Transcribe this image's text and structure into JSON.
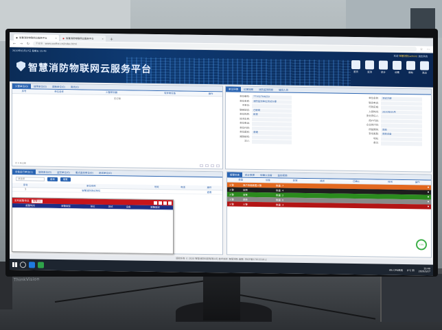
{
  "browser": {
    "tabs": [
      {
        "label": "智慧消防物联网云服务平台",
        "active": true
      },
      {
        "label": "智慧消防物联网云服务平台",
        "active": false
      }
    ],
    "new_tab": "+",
    "url_prefix": "不安全",
    "url": "www.xxxfire.cn/index.html"
  },
  "header": {
    "topline": "2020年03月27日 星期五 15:49",
    "welcome": "欢迎",
    "user": "智慧消防(admin)",
    "logout": "退出系统",
    "title": "智慧消防物联网云服务平台",
    "nav": [
      {
        "label": "首页",
        "icon": "home-icon"
      },
      {
        "label": "监测",
        "icon": "monitor-icon"
      },
      {
        "label": "统计",
        "icon": "chart-icon"
      },
      {
        "label": "设置",
        "icon": "settings-icon"
      },
      {
        "label": "帮助",
        "icon": "help-icon"
      },
      {
        "label": "退出",
        "icon": "logout-icon"
      }
    ]
  },
  "list_panel": {
    "tabs": [
      "火警单位(0)",
      "故障单位(0)",
      "屏蔽单位(0)",
      "离线(0)"
    ],
    "columns": [
      "序号",
      "单位名称",
      "火警探测器",
      "有异常设备",
      "操作"
    ],
    "empty": "无记录",
    "pager": "共 0 条记录"
  },
  "detail_panel": {
    "tabs": [
      "单位详情",
      "位置地图",
      "消防监测视频",
      "值班人员"
    ],
    "left_fields": [
      {
        "k": "单位编号:",
        "v": "77102704650"
      },
      {
        "k": "单位名称:",
        "v": "消防监测单位测试大楼"
      },
      {
        "k": "子单位:",
        "v": ""
      },
      {
        "k": "联网状态:",
        "v": "已联网"
      },
      {
        "k": "单位性质:",
        "v": "民营"
      },
      {
        "k": "技术负责:",
        "v": ""
      },
      {
        "k": "单位电话:",
        "v": ""
      },
      {
        "k": "单位代码:",
        "v": ""
      },
      {
        "k": "单位类别:",
        "v": "普通"
      },
      {
        "k": "建筑结构:",
        "v": ""
      },
      {
        "k": "法人:",
        "v": ""
      }
    ],
    "right_fields": [
      {
        "k": "单位名称:",
        "v": "测试大楼"
      },
      {
        "k": "联系电话:",
        "v": ""
      },
      {
        "k": "行政区域:",
        "v": ""
      },
      {
        "k": "入网时间:",
        "v": "2020年03月"
      },
      {
        "k": "安全责任人:",
        "v": ""
      },
      {
        "k": "用户代码:",
        "v": ""
      },
      {
        "k": "企业统计码:",
        "v": ""
      },
      {
        "k": "所属建筑:",
        "v": "其他"
      },
      {
        "k": "安全类型:",
        "v": "其他设备"
      },
      {
        "k": "地址:",
        "v": ""
      },
      {
        "k": "备注:",
        "v": ""
      }
    ]
  },
  "units_panel": {
    "tabs": [
      "设备运行单位(1)",
      "联网单位(0)",
      "监控单位(0)",
      "重点监控单位(0)",
      "测试单位(0)"
    ],
    "select_placeholder": "请选择",
    "search_label": "查询",
    "reset_label": "重置",
    "columns": [
      "序号",
      "单位名称",
      "地址",
      "电话",
      "操作"
    ],
    "rows": [
      {
        "no": "1",
        "name": "智慧消防测试单位",
        "addr": "",
        "tel": "",
        "op": "查看"
      }
    ]
  },
  "alarm_popup": {
    "title": "实时报警信息",
    "badge": "报警(1)",
    "columns": [
      "报警时间",
      "报警类型",
      "单位",
      "测试",
      "设备",
      "报警描述"
    ]
  },
  "alarm_panel": {
    "tabs": [
      "报警信息",
      "统计数据",
      "待确认设备",
      "监控视频"
    ],
    "columns": [
      "类型",
      "设备",
      "区域",
      "描述",
      "已确认",
      "时间",
      "操作"
    ],
    "rows": [
      {
        "tag": "火警",
        "type": "用户传输装置火警",
        "count": "数量: 7",
        "color": "#e2681f"
      },
      {
        "tag": "火警",
        "type": "故障",
        "count": "数量: 4",
        "color": "#1e1e1e"
      },
      {
        "tag": "火警",
        "type": "监管",
        "count": "数量: 2",
        "color": "#2b8a1e"
      },
      {
        "tag": "火警",
        "type": "屏蔽",
        "count": "数量: 0",
        "color": "#8a8a8a"
      },
      {
        "tag": "火警",
        "type": "火警",
        "count": "数量: 3",
        "color": "#b31515"
      }
    ],
    "percent": "73%"
  },
  "footer": "版权所有 © 2020 智慧消防科技有限公司 技术支持: 智慧消防 备案: 苏ICP备17013316-2",
  "taskbar": {
    "cpu": "4% CPU使用",
    "temp": "9°C 阴",
    "time": "15:49",
    "date": "2020/3/27"
  },
  "bezel": {
    "brand": "ThinkVision"
  }
}
